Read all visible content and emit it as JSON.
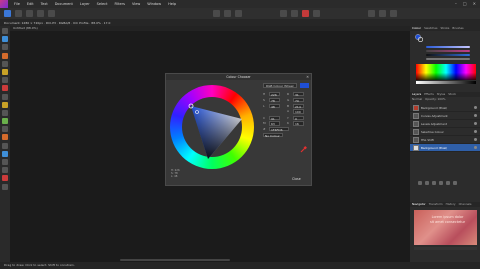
{
  "menu": {
    "items": [
      "File",
      "Edit",
      "Text",
      "Document",
      "Layer",
      "Select",
      "Filters",
      "View",
      "Window",
      "Help"
    ]
  },
  "context_bar": {
    "text": "Document: 1280 × 720px · DCI-P3 · RGBA/8 · ICC Profile · 88.0% · 17.0"
  },
  "document_tab": {
    "label": "Untitled (88.0%)"
  },
  "dialog": {
    "title": "Colour Chooser",
    "mode_select": "RGB Colour Wheel",
    "current_color": "#1f4fd6",
    "fields": [
      {
        "label": "H",
        "value": "226",
        "label2": "R",
        "value2": "31"
      },
      {
        "label": "S",
        "value": "78",
        "label2": "G",
        "value2": "79"
      },
      {
        "label": "L",
        "value": "48",
        "label2": "B",
        "value2": "214"
      },
      {
        "label": "",
        "value": "",
        "label2": "A",
        "value2": "100"
      }
    ],
    "hex_label": "#",
    "hex_value": "1F4FD6",
    "extra_fields": [
      {
        "label": "C",
        "value": "91"
      },
      {
        "label": "M",
        "value": "63"
      },
      {
        "label": "Y",
        "value": "0"
      },
      {
        "label": "K",
        "value": "16"
      }
    ],
    "no_colour_label": "No Colour",
    "legend": [
      "H: 226",
      "S: 78",
      "L: 48"
    ],
    "close_label": "Close"
  },
  "right_panel": {
    "top_tabs": [
      "Colour",
      "Swatches",
      "Stroke",
      "Brushes"
    ],
    "layers_tabs": [
      "Layers",
      "Effects",
      "Styles",
      "Stock"
    ],
    "blend_label": "Normal",
    "opacity_label": "Opacity: 100%",
    "layers": [
      {
        "name": "Background (Pixel)",
        "thumb": "red",
        "selected": false
      },
      {
        "name": "Curves Adjustment",
        "thumb": "gray",
        "selected": false
      },
      {
        "name": "Levels Adjustment",
        "thumb": "gray",
        "selected": false
      },
      {
        "name": "Selective Colour",
        "thumb": "gray",
        "selected": false
      },
      {
        "name": "HSL Shift",
        "thumb": "gray",
        "selected": false
      },
      {
        "name": "Background (Pixel)",
        "thumb": "white",
        "selected": true
      }
    ],
    "navigator_tabs": [
      "Navigator",
      "Transform",
      "History",
      "Channels"
    ],
    "navigator_text": [
      "Lorem ipsum dolor",
      "sit amet consectetur"
    ]
  },
  "status": {
    "text": "Drag to draw. Click to select. Shift to constrain."
  },
  "colors": {
    "accent": "#3b78d8",
    "selected_layer": "#2f5fa8"
  }
}
